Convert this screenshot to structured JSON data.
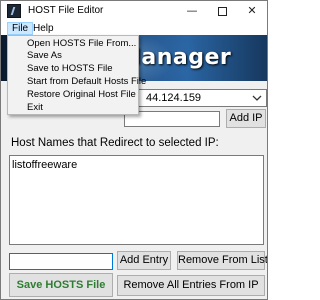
{
  "window": {
    "title": "HOST File Editor",
    "minimize_glyph": "—",
    "close_glyph": "✕"
  },
  "menubar": {
    "file_label": "File",
    "help_label": "Help"
  },
  "file_menu": {
    "items": [
      "Open HOSTS File From...",
      "Save As",
      "Save to HOSTS File",
      "Start from Default Hosts File",
      "Restore Original Host File",
      "Exit"
    ]
  },
  "banner": {
    "text": "Manager"
  },
  "ip_select": {
    "value": "44.124.159"
  },
  "ip_input": {
    "value": "",
    "placeholder": ""
  },
  "buttons": {
    "add_ip": "Add IP",
    "add_entry": "Add Entry",
    "remove_from_list": "Remove From List",
    "save_hosts": "Save HOSTS File",
    "remove_all": "Remove All Entries From IP"
  },
  "redirect_label": "Host Names that Redirect to selected IP:",
  "hosts_list": {
    "items": [
      "listoffreeware"
    ]
  },
  "host_input": {
    "value": ""
  },
  "colors": {
    "save_button_text": "#2e7d32",
    "menu_highlight": "#cce8ff",
    "focus_border": "#0078d7"
  }
}
